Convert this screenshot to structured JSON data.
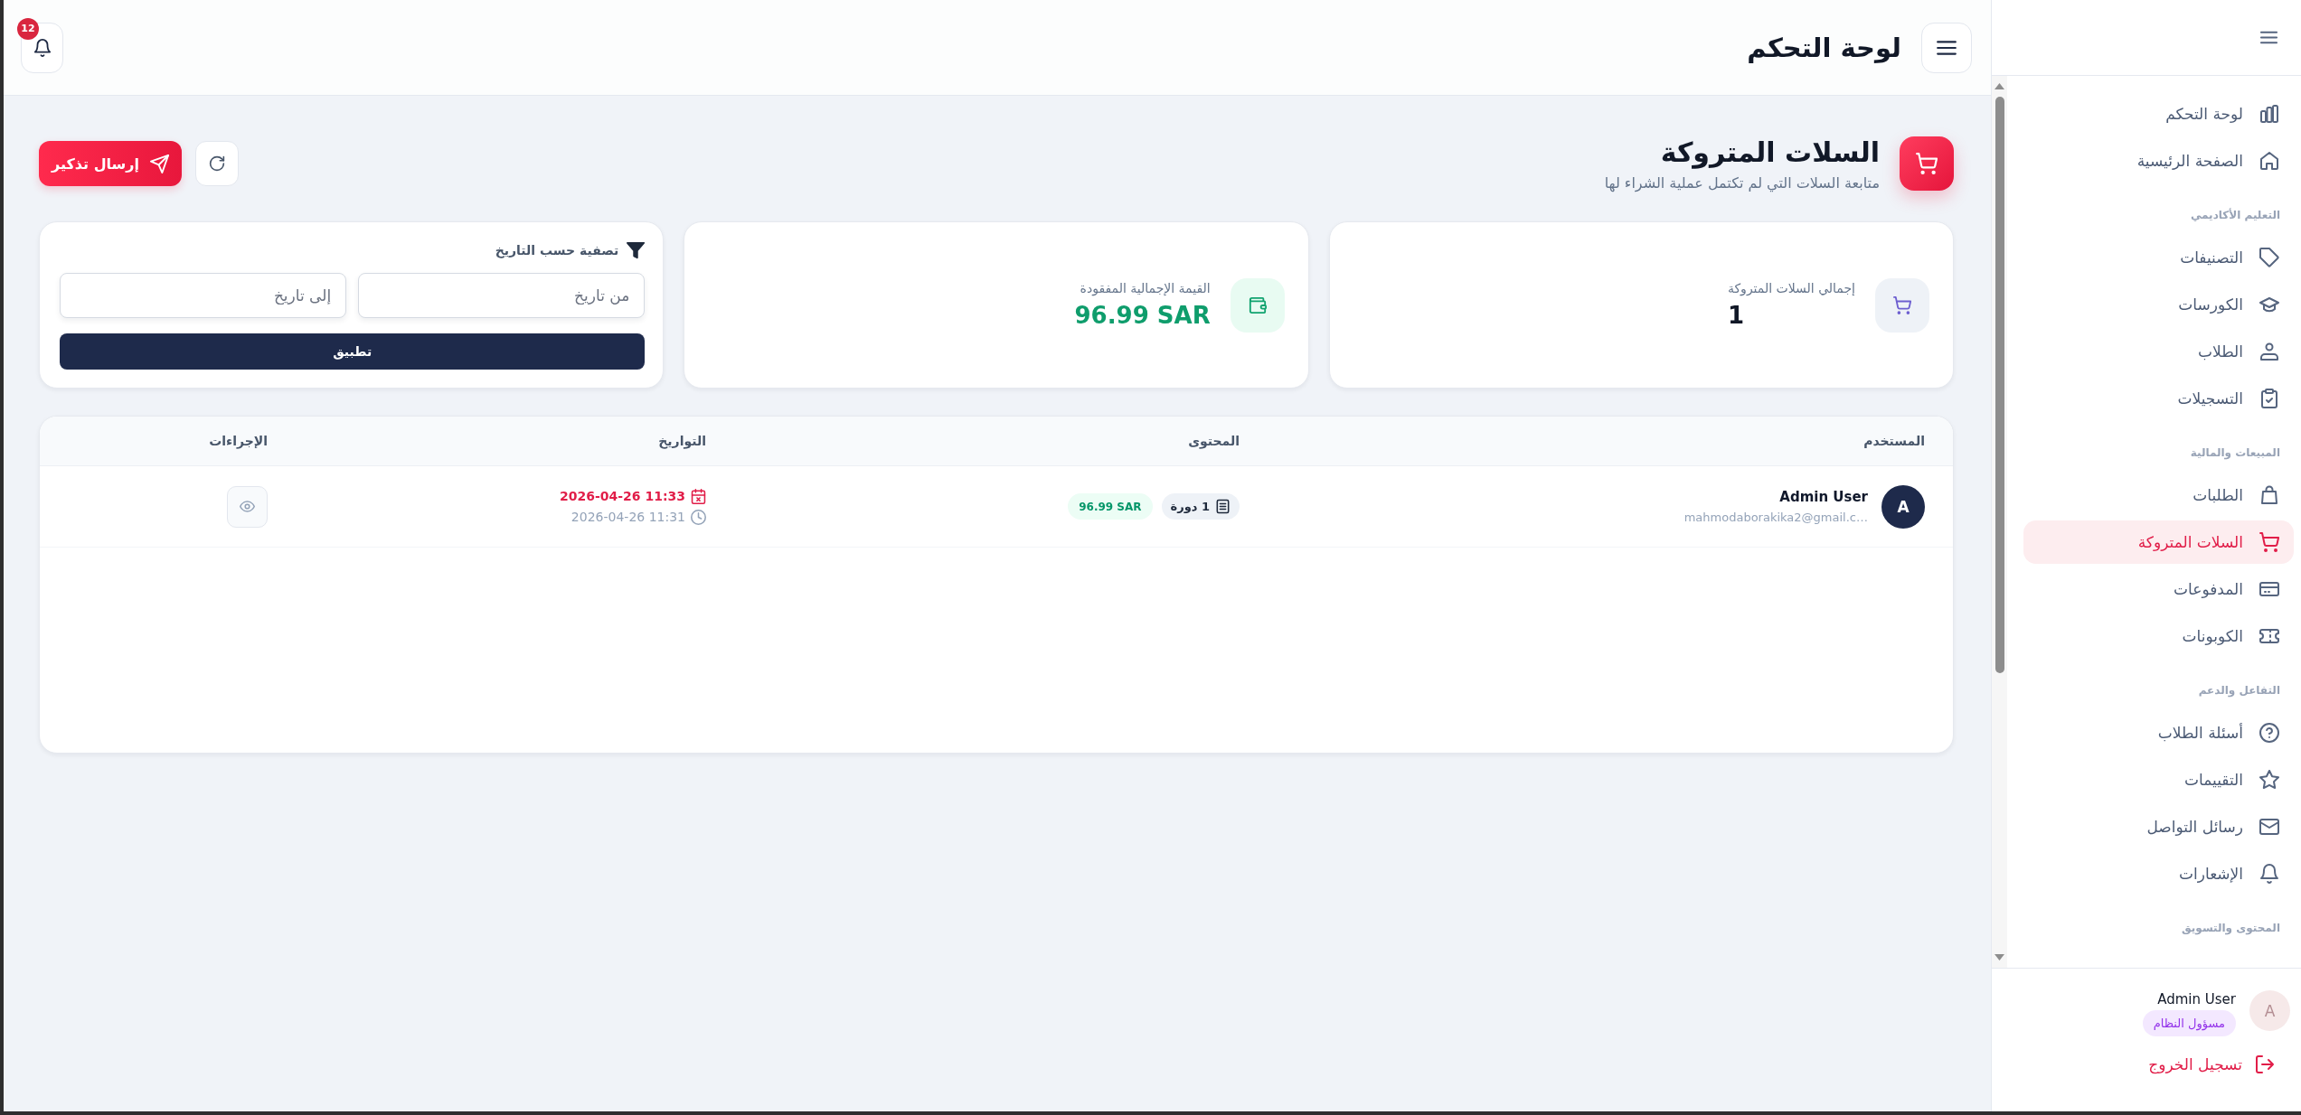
{
  "sidebar": {
    "sections": [
      {
        "items": [
          {
            "label": "لوحة التحكم",
            "selected": false
          },
          {
            "label": "الصفحة الرئيسية",
            "selected": false
          }
        ]
      },
      {
        "title": "التعليم الأكاديمي",
        "items": [
          {
            "label": "التصنيفات",
            "selected": false
          },
          {
            "label": "الكورسات",
            "selected": false
          },
          {
            "label": "الطلاب",
            "selected": false
          },
          {
            "label": "التسجيلات",
            "selected": false
          }
        ]
      },
      {
        "title": "المبيعات والمالية",
        "items": [
          {
            "label": "الطلبات",
            "selected": false
          },
          {
            "label": "السلات المتروكة",
            "selected": true
          },
          {
            "label": "المدفوعات",
            "selected": false
          },
          {
            "label": "الكوبونات",
            "selected": false
          }
        ]
      },
      {
        "title": "التفاعل والدعم",
        "items": [
          {
            "label": "أسئلة الطلاب",
            "selected": false
          },
          {
            "label": "التقييمات",
            "selected": false
          },
          {
            "label": "رسائل التواصل",
            "selected": false
          },
          {
            "label": "الإشعارات",
            "selected": false
          }
        ]
      },
      {
        "title": "المحتوى والتسويق"
      }
    ],
    "user": {
      "avatar": "A",
      "name": "Admin User",
      "role": "مسؤول النظام"
    },
    "logout": "تسجيل الخروج"
  },
  "top_bar": {
    "title": "لوحة التحكم",
    "notification_count": "12"
  },
  "page_header": {
    "title": "السلات المتروكة",
    "subtitle": "متابعة السلات التي لم تكتمل عملية الشراء لها",
    "send_button": "إرسال تذكير"
  },
  "stats": [
    {
      "kind": "count",
      "label": "إجمالي السلات المتروكة",
      "value": "1"
    },
    {
      "kind": "money",
      "label": "القيمة الإجمالية المفقودة",
      "value": "96.99 SAR"
    }
  ],
  "filter": {
    "title": "تصفية حسب التاريخ",
    "from_field": {
      "placeholder": "من تاريخ"
    },
    "to_field": {
      "placeholder": "إلى تاريخ"
    },
    "apply_button": "تطبيق"
  },
  "table": {
    "columns": [
      "المستخدم",
      "المحتوى",
      "التواريخ",
      "الإجراءات"
    ],
    "rows": [
      {
        "user": {
          "avatar": "A",
          "name": "Admin User",
          "email": "mahmodaborakika2@gmail.c…"
        },
        "items": "1 دورة",
        "total": "96.99 SAR",
        "dates": [
          {
            "kind": "highlight",
            "text": "2026-04-26 11:33"
          },
          {
            "kind": "plain",
            "text": "2026-04-26 11:31"
          }
        ]
      }
    ]
  }
}
